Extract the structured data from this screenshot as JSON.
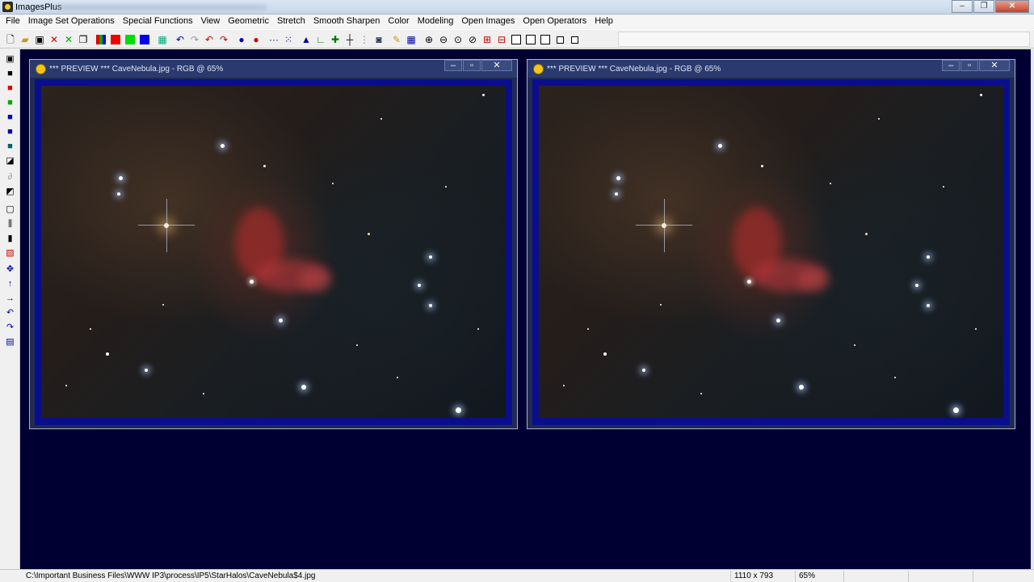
{
  "window": {
    "title": "ImagesPlus"
  },
  "menu": [
    "File",
    "Image Set Operations",
    "Special Functions",
    "View",
    "Geometric",
    "Stretch",
    "Smooth Sharpen",
    "Color",
    "Modeling",
    "Open Images",
    "Open Operators",
    "Help"
  ],
  "toolbar": {
    "accent": "#0a0e8c"
  },
  "previews": [
    {
      "title": "*** PREVIEW *** CaveNebula.jpg - RGB @ 65%"
    },
    {
      "title": "*** PREVIEW *** CaveNebula.jpg - RGB @ 65%"
    }
  ],
  "statusbar": {
    "path": "C:\\Important Business Files\\WWW IP3\\process\\IP5\\StarHalos\\CaveNebula$4.jpg",
    "dimensions": "1110 x 793",
    "zoom": "65%"
  },
  "colors": {
    "workspace": "#000033",
    "preview_frame": "#0a0e8c"
  }
}
